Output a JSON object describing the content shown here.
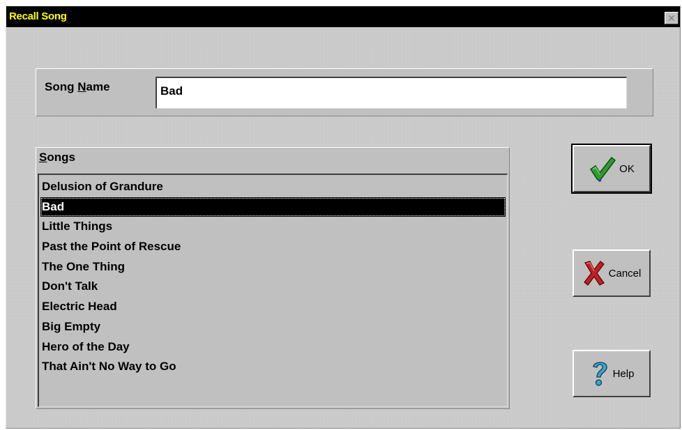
{
  "window": {
    "title": "Recall Song",
    "close_glyph": "✕"
  },
  "song_name": {
    "label_pre": "Song ",
    "label_mnemonic": "N",
    "label_post": "ame",
    "value": "Bad"
  },
  "songs": {
    "label_mnemonic": "S",
    "label_post": "ongs",
    "items": [
      "Delusion of Grandure",
      "Bad",
      "Little Things",
      "Past the Point of Rescue",
      "The One Thing",
      "Don't Talk",
      "Electric Head",
      "Big Empty",
      "Hero of the Day",
      "That Ain't No Way to Go"
    ],
    "selected_index": 1
  },
  "buttons": {
    "ok": {
      "label": "OK",
      "icon": "checkmark-icon"
    },
    "cancel": {
      "label": "Cancel",
      "icon": "red-x-icon"
    },
    "help": {
      "label": "Help",
      "icon": "question-mark-icon"
    }
  },
  "colors": {
    "title_bar": "#000000",
    "title_text": "#ffff00",
    "face": "#c0c0c0",
    "selection": "#000000"
  }
}
